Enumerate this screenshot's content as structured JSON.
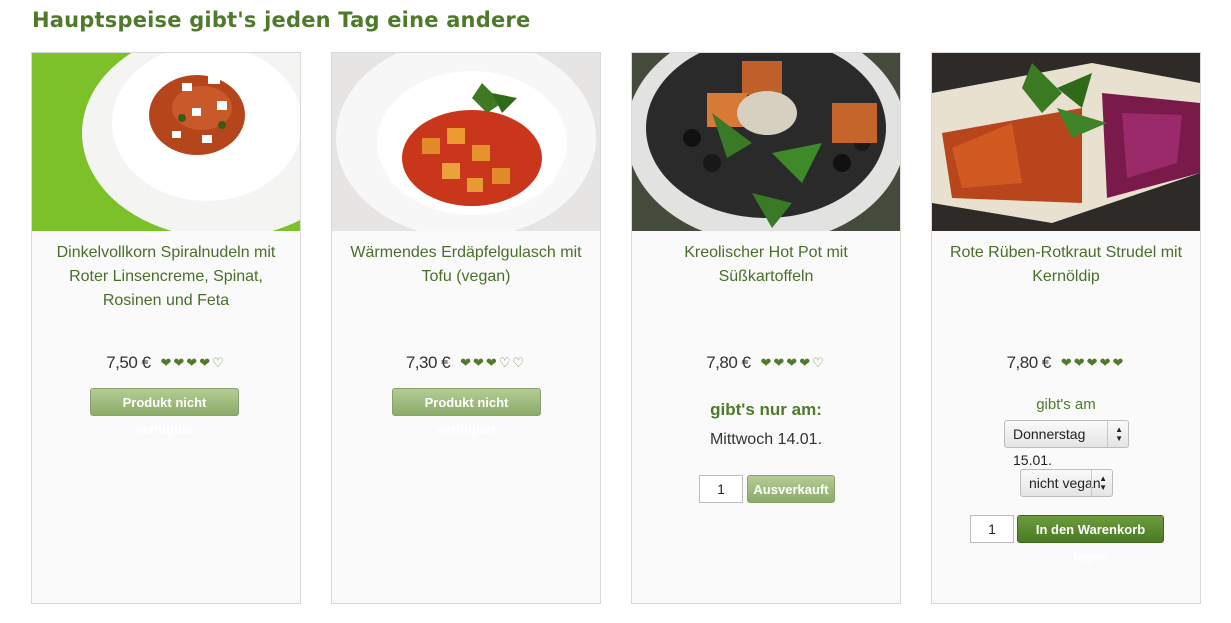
{
  "section": {
    "title": "Hauptspeise gibt's jeden Tag eine andere"
  },
  "products": [
    {
      "title": "Dinkelvollkorn Spiralnudeln mit Roter Linsencreme, Spinat, Rosinen und Feta",
      "price": "7,50 €",
      "rating": 4,
      "rating_max": 5,
      "button": "Produkt nicht verfügbar"
    },
    {
      "title": "Wärmendes Erdäpfelgulasch mit Tofu (vegan)",
      "price": "7,30 €",
      "rating": 3,
      "rating_max": 5,
      "button": "Produkt nicht verfügbar"
    },
    {
      "title": "Kreolischer Hot Pot mit Süßkartoffeln",
      "price": "7,80 €",
      "rating": 4,
      "rating_max": 5,
      "only_label": "gibt's nur am:",
      "only_date": "Mittwoch 14.01.",
      "quantity": "1",
      "button": "Ausverkauft"
    },
    {
      "title": "Rote Rüben-Rotkraut Strudel mit Kernöldip",
      "price": "7,80 €",
      "rating": 5,
      "rating_max": 5,
      "available_label": "gibt's am",
      "date_select": "Donnerstag 15.01.",
      "diet_select": "nicht vegan",
      "quantity": "1",
      "button": "In den Warenkorb legen"
    }
  ],
  "colors": {
    "accent": "#4e7a2a",
    "button_disabled": "#9cb97a",
    "button_active": "#5a8a30"
  }
}
